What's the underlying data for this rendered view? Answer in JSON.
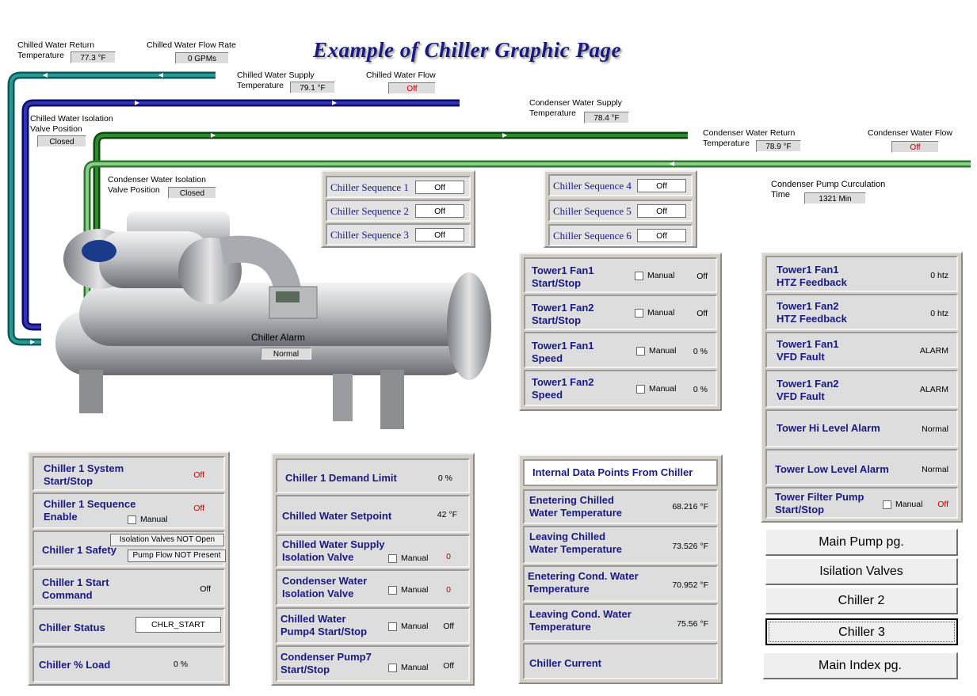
{
  "page": {
    "title": "Example of Chiller Graphic Page"
  },
  "readouts": {
    "chw_return_temp": {
      "label1": "Chilled Water Return",
      "label2": "Temperature",
      "value": "77.3 °F"
    },
    "chw_flow_rate": {
      "label": "Chilled Water Flow Rate",
      "value": "0 GPMs"
    },
    "chw_supply_temp": {
      "label1": "Chilled Water Supply",
      "label2": "Temperature",
      "value": "79.1 °F"
    },
    "chw_flow": {
      "label": "Chilled Water Flow",
      "value": "Off"
    },
    "chw_isolation": {
      "label1": "Chilled Water Isolation",
      "label2": "Valve Position",
      "value": "Closed"
    },
    "cw_supply_temp": {
      "label1": "Condenser Water Supply",
      "label2": "Temperature",
      "value": "78.4 °F"
    },
    "cw_return_temp": {
      "label1": "Condenser Water Return",
      "label2": "Temperature",
      "value": "78.9 °F"
    },
    "cw_flow": {
      "label": "Condenser Water Flow",
      "value": "Off"
    },
    "cw_isolation": {
      "label1": "Condenser Water Isolation",
      "label2": "Valve Position",
      "value": "Closed"
    },
    "cond_pump_circ": {
      "label1": "Condenser Pump Curculation",
      "label2": "Time",
      "value": "1321 Min"
    },
    "chiller_alarm": {
      "label": "Chiller Alarm",
      "value": "Normal"
    }
  },
  "sequences_left": [
    {
      "label": "Chiller Sequence 1",
      "value": "Off"
    },
    {
      "label": "Chiller Sequence 2",
      "value": "Off"
    },
    {
      "label": "Chiller Sequence 3",
      "value": "Off"
    }
  ],
  "sequences_right": [
    {
      "label": "Chiller Sequence 4",
      "value": "Off"
    },
    {
      "label": "Chiller Sequence 5",
      "value": "Off"
    },
    {
      "label": "Chiller Sequence 6",
      "value": "Off"
    }
  ],
  "manual_label": "Manual",
  "tower_fans": [
    {
      "l1": "Tower1 Fan1",
      "l2": "Start/Stop",
      "value": "Off"
    },
    {
      "l1": "Tower1 Fan2",
      "l2": "Start/Stop",
      "value": "Off"
    },
    {
      "l1": "Tower1 Fan1",
      "l2": "Speed",
      "value": "0 %"
    },
    {
      "l1": "Tower1 Fan2",
      "l2": "Speed",
      "value": "0 %"
    }
  ],
  "tower_status": [
    {
      "l1": "Tower1 Fan1",
      "l2": "HTZ Feedback",
      "value": "0 htz"
    },
    {
      "l1": "Tower1 Fan2",
      "l2": "HTZ Feedback",
      "value": "0 htz"
    },
    {
      "l1": "Tower1 Fan1",
      "l2": "VFD Fault",
      "value": "ALARM"
    },
    {
      "l1": "Tower1 Fan2",
      "l2": "VFD Fault",
      "value": "ALARM"
    },
    {
      "l1": "Tower Hi Level Alarm",
      "l2": "",
      "value": "Normal"
    },
    {
      "l1": "Tower  Low Level Alarm",
      "l2": "",
      "value": "Normal"
    },
    {
      "l1": "Tower Filter Pump",
      "l2": "Start/Stop",
      "value": "Off"
    }
  ],
  "chiller1": {
    "system": {
      "l1": "Chiller 1 System",
      "l2": "Start/Stop",
      "value": "Off"
    },
    "sequence": {
      "l1": "Chiller 1 Sequence",
      "l2": "Enable",
      "value": "Off"
    },
    "safety": {
      "label": "Chiller 1 Safety",
      "msg1": "Isolation Valves NOT Open",
      "msg2": "Pump Flow NOT Present"
    },
    "start": {
      "l1": "Chiller 1 Start",
      "l2": "Command",
      "value": "Off"
    },
    "status": {
      "label": "Chiller Status",
      "value": "CHLR_START"
    },
    "load": {
      "label": "Chiller % Load",
      "value": "0 %"
    }
  },
  "setpoints": [
    {
      "l1": "Chiller 1 Demand Limit",
      "l2": "",
      "value": "0 %",
      "manual": false,
      "red": false
    },
    {
      "l1": "Chilled Water Setpoint",
      "l2": "",
      "value": "42 °F",
      "manual": false,
      "red": false
    },
    {
      "l1": "Chilled Water Supply",
      "l2": "Isolation Valve",
      "value": "0",
      "manual": true,
      "red": true
    },
    {
      "l1": "Condenser Water",
      "l2": "Isolation Valve",
      "value": "0",
      "manual": true,
      "red": true
    },
    {
      "l1": "Chilled Water",
      "l2": "Pump4 Start/Stop",
      "value": "Off",
      "manual": true,
      "red": false
    },
    {
      "l1": "Condenser Pump7",
      "l2": "Start/Stop",
      "value": "Off",
      "manual": true,
      "red": false
    }
  ],
  "internal": {
    "header": "Internal Data Points From Chiller",
    "rows": [
      {
        "l1": "Enetering Chilled",
        "l2": "Water Temperature",
        "value": "68.216 °F"
      },
      {
        "l1": "Leaving Chilled",
        "l2": "Water Temperature",
        "value": "73.526 °F"
      },
      {
        "l1": "Enetering Cond. Water",
        "l2": "Temperature",
        "value": "70.952 °F"
      },
      {
        "l1": "Leaving Cond. Water",
        "l2": "Temperature",
        "value": "75.56 °F"
      },
      {
        "l1": "Chiller Current",
        "l2": "",
        "value": ""
      }
    ]
  },
  "nav": {
    "main_pump": "Main Pump pg.",
    "isolation": "Isilation Valves",
    "chiller2": "Chiller 2",
    "chiller3": "Chiller 3",
    "main_index": "Main Index pg."
  },
  "colors": {
    "teal": "#1a7a78",
    "navy": "#1a1a8c",
    "green_dark": "#1e6a1e",
    "green_light": "#5aa55a",
    "label_blue": "#1a1a80",
    "alarm_red": "#c00000"
  }
}
